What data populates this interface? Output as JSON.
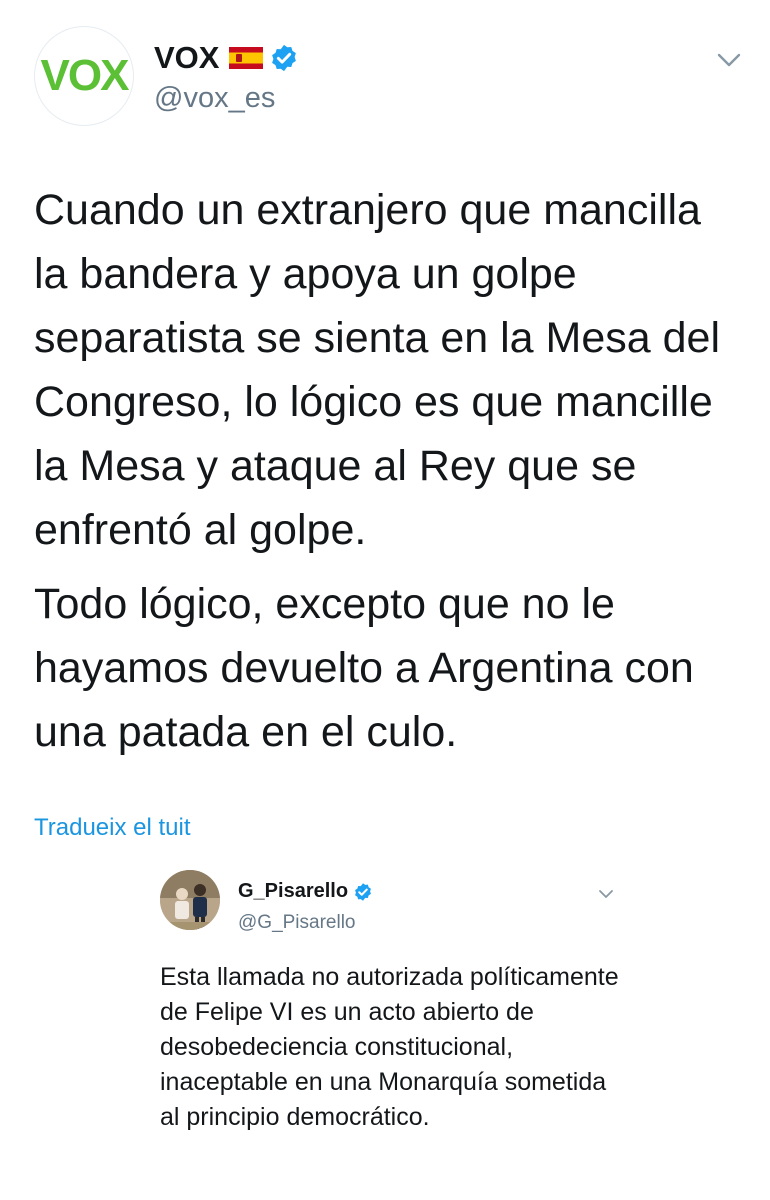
{
  "tweet": {
    "avatar_text": "VOX",
    "display_name": "VOX",
    "handle": "@vox_es",
    "paragraphs": [
      "Cuando un extranjero que mancilla la bandera y apoya un golpe separatista se sienta en la Mesa del Congreso, lo lógico es que mancille la Mesa y ataque al Rey que se enfrentó al golpe.",
      "Todo lógico, excepto que no le hayamos devuelto a Argentina con una patada en el culo."
    ],
    "translate_label": "Tradueix el tuit"
  },
  "quoted_tweet": {
    "display_name": "G_Pisarello",
    "handle": "@G_Pisarello",
    "text": "Esta llamada no autorizada políticamente de Felipe VI es un acto abierto de desobedeciencia constitucional, inaceptable en una Monarquía sometida al principio democrático."
  },
  "icons": [
    "spain-flag-icon",
    "verified-icon",
    "chevron-down-icon"
  ],
  "colors": {
    "text": "#14171a",
    "secondary": "#657786",
    "link": "#1b95e0",
    "verified": "#1da1f2",
    "vox_green": "#5bc035"
  }
}
